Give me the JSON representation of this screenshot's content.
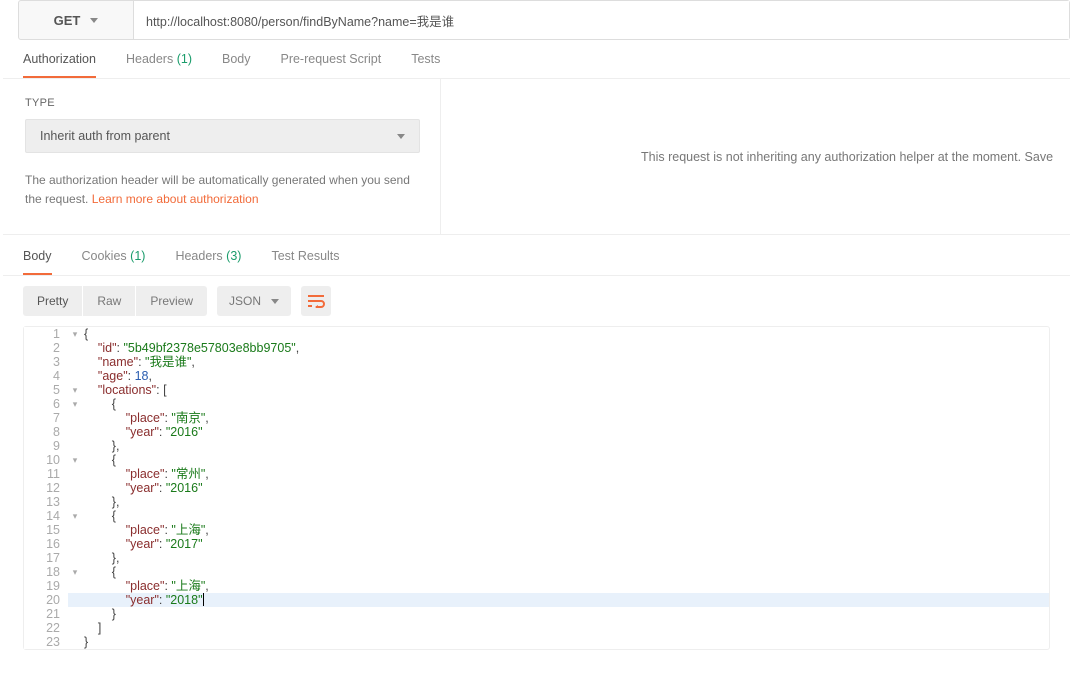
{
  "request": {
    "method": "GET",
    "url": "http://localhost:8080/person/findByName?name=我是谁"
  },
  "requestTabs": {
    "authorization": "Authorization",
    "headers_label": "Headers",
    "headers_count": "(1)",
    "body": "Body",
    "prerequest": "Pre-request Script",
    "tests": "Tests"
  },
  "auth": {
    "type_label": "TYPE",
    "selected": "Inherit auth from parent",
    "desc_pre": "The authorization header will be automatically generated when you send the request. ",
    "learn_more": "Learn more about authorization",
    "right_msg": "This request is not inheriting any authorization helper at the moment. Save"
  },
  "responseTabs": {
    "body": "Body",
    "cookies_label": "Cookies",
    "cookies_count": "(1)",
    "headers_label": "Headers",
    "headers_count": "(3)",
    "test_results": "Test Results"
  },
  "toolbar": {
    "pretty": "Pretty",
    "raw": "Raw",
    "preview": "Preview",
    "format": "JSON"
  },
  "code": {
    "l1": "{",
    "l2_k": "\"id\"",
    "l2_v": "\"5b49bf2378e57803e8bb9705\"",
    "l3_k": "\"name\"",
    "l3_v": "\"我是谁\"",
    "l4_k": "\"age\"",
    "l4_v": "18",
    "l5_k": "\"locations\"",
    "l7_k": "\"place\"",
    "l7_v": "\"南京\"",
    "l8_k": "\"year\"",
    "l8_v": "\"2016\"",
    "l11_k": "\"place\"",
    "l11_v": "\"常州\"",
    "l12_k": "\"year\"",
    "l12_v": "\"2016\"",
    "l15_k": "\"place\"",
    "l15_v": "\"上海\"",
    "l16_k": "\"year\"",
    "l16_v": "\"2017\"",
    "l19_k": "\"place\"",
    "l19_v": "\"上海\"",
    "l20_k": "\"year\"",
    "l20_v": "\"2018\""
  }
}
